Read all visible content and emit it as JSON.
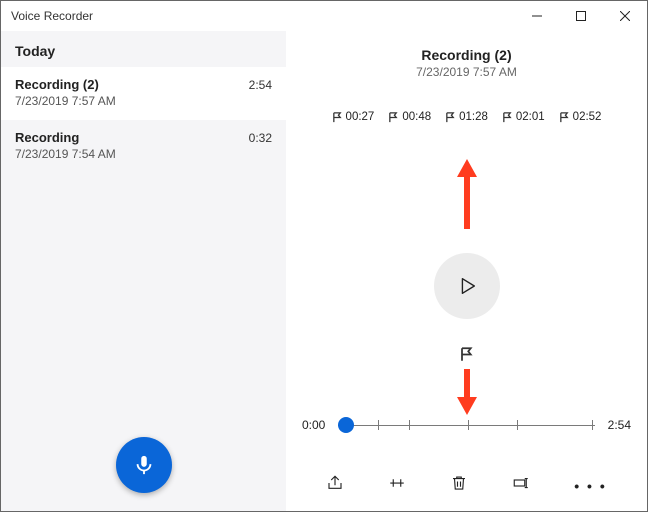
{
  "app": {
    "title": "Voice Recorder"
  },
  "sidebar": {
    "group": "Today",
    "items": [
      {
        "name": "Recording (2)",
        "date": "7/23/2019 7:57 AM",
        "duration": "2:54"
      },
      {
        "name": "Recording",
        "date": "7/23/2019 7:54 AM",
        "duration": "0:32"
      }
    ]
  },
  "main": {
    "name": "Recording (2)",
    "date": "7/23/2019 7:57 AM",
    "markers": [
      "00:27",
      "00:48",
      "01:28",
      "02:01",
      "02:52"
    ],
    "timeline": {
      "start": "0:00",
      "end": "2:54"
    },
    "actions": {
      "more": "• • •"
    }
  },
  "colors": {
    "accent": "#0a66d8",
    "annotation": "#ff3c1f"
  }
}
